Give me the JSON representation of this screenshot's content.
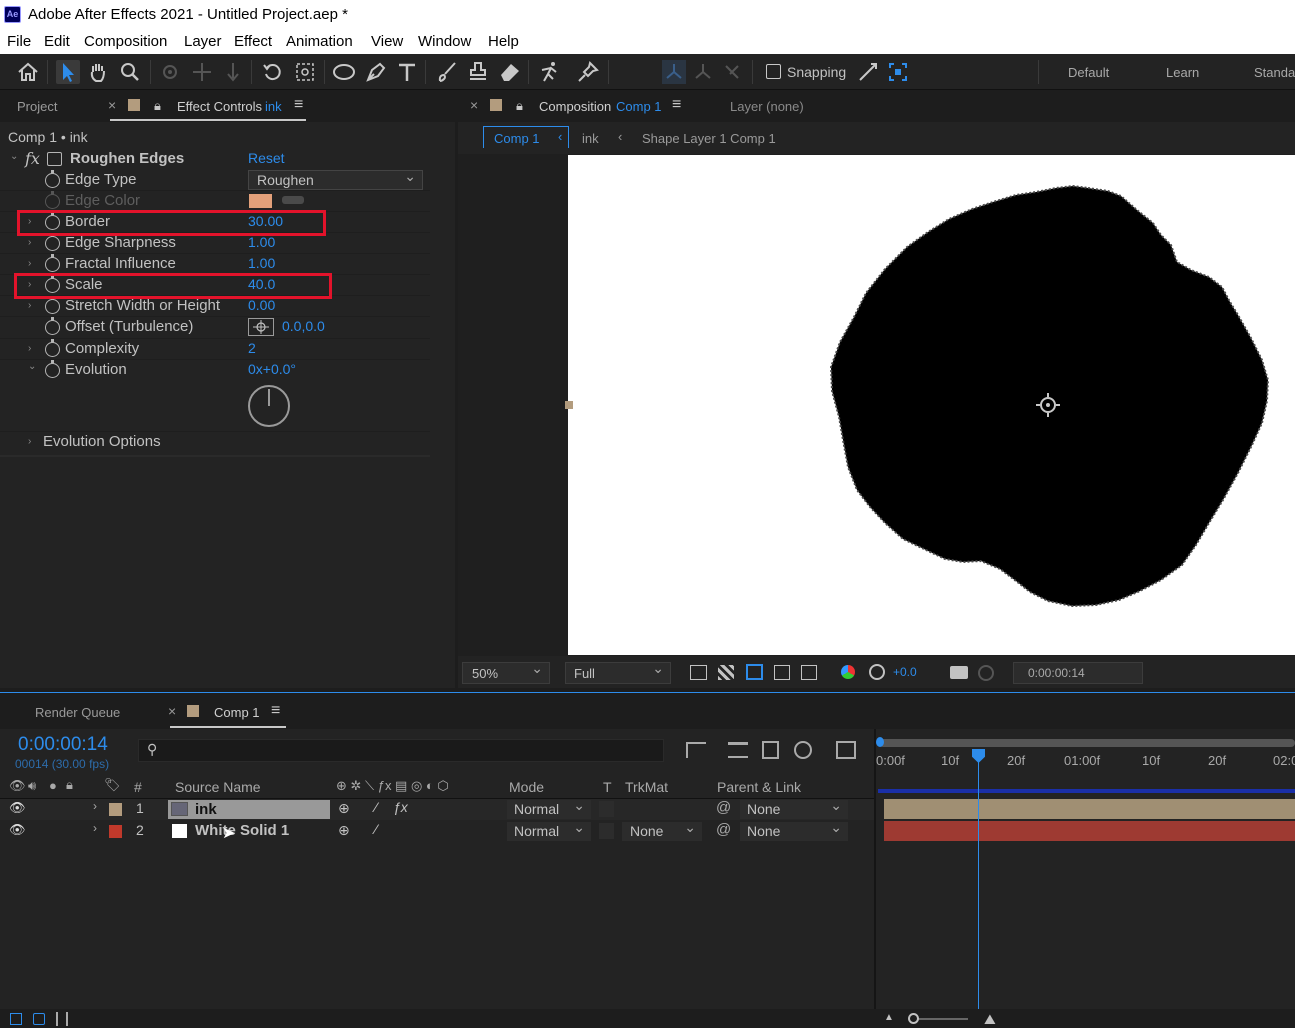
{
  "app": {
    "title": "Adobe After Effects 2021 - Untitled Project.aep *",
    "logo": "Ae"
  },
  "menu": [
    "File",
    "Edit",
    "Composition",
    "Layer",
    "Effect",
    "Animation",
    "View",
    "Window",
    "Help"
  ],
  "toolbar": {
    "snapping_label": "Snapping",
    "workspaces": [
      "Default",
      "Learn",
      "Standa"
    ]
  },
  "left_panel": {
    "tab_project": "Project",
    "tab_effect_controls": "Effect Controls",
    "tab_effect_controls_layer": "ink",
    "breadcrumb": "Comp 1 • ink",
    "effect_name": "Roughen Edges",
    "fx_label": "fx",
    "reset_label": "Reset",
    "properties": [
      {
        "label": "Edge Type",
        "value": "Roughen"
      },
      {
        "label": "Edge Color",
        "value": ""
      },
      {
        "label": "Border",
        "value": "30.00"
      },
      {
        "label": "Edge Sharpness",
        "value": "1.00"
      },
      {
        "label": "Fractal Influence",
        "value": "1.00"
      },
      {
        "label": "Scale",
        "value": "40.0"
      },
      {
        "label": "Stretch Width or Height",
        "value": "0.00"
      },
      {
        "label": "Offset (Turbulence)",
        "value": "0.0,0.0"
      },
      {
        "label": "Complexity",
        "value": "2"
      },
      {
        "label": "Evolution",
        "value": "0x+0.0°"
      },
      {
        "label": "Evolution Options",
        "value": ""
      }
    ],
    "edge_color_hex": "#e3a07a"
  },
  "comp_panel": {
    "tab_composition": "Composition",
    "tab_composition_name": "Comp 1",
    "tab_layer": "Layer (none)",
    "flow": [
      "Comp 1",
      "ink",
      "Shape Layer 1 Comp 1"
    ],
    "zoom": "50%",
    "resolution": "Full",
    "exposure": "+0.0",
    "timecode": "0:00:00:14"
  },
  "timeline": {
    "tab_render_queue": "Render Queue",
    "tab_comp": "Comp 1",
    "current_time": "0:00:00:14",
    "frame_info": "00014 (30.00 fps)",
    "search_placeholder": "",
    "col_source_name": "Source Name",
    "col_hash": "#",
    "col_mode": "Mode",
    "col_t": "T",
    "col_trkmat": "TrkMat",
    "col_parent": "Parent & Link",
    "layers": [
      {
        "num": "1",
        "name": "ink",
        "mode": "Normal",
        "trkmat": "",
        "parent": "None",
        "label_color": "#b39c7e"
      },
      {
        "num": "2",
        "name": "White Solid 1",
        "mode": "Normal",
        "trkmat": "None",
        "parent": "None",
        "label_color": "#c0392b"
      }
    ],
    "ruler": [
      "0:00f",
      "10f",
      "20f",
      "01:00f",
      "10f",
      "20f",
      "02:0"
    ]
  }
}
